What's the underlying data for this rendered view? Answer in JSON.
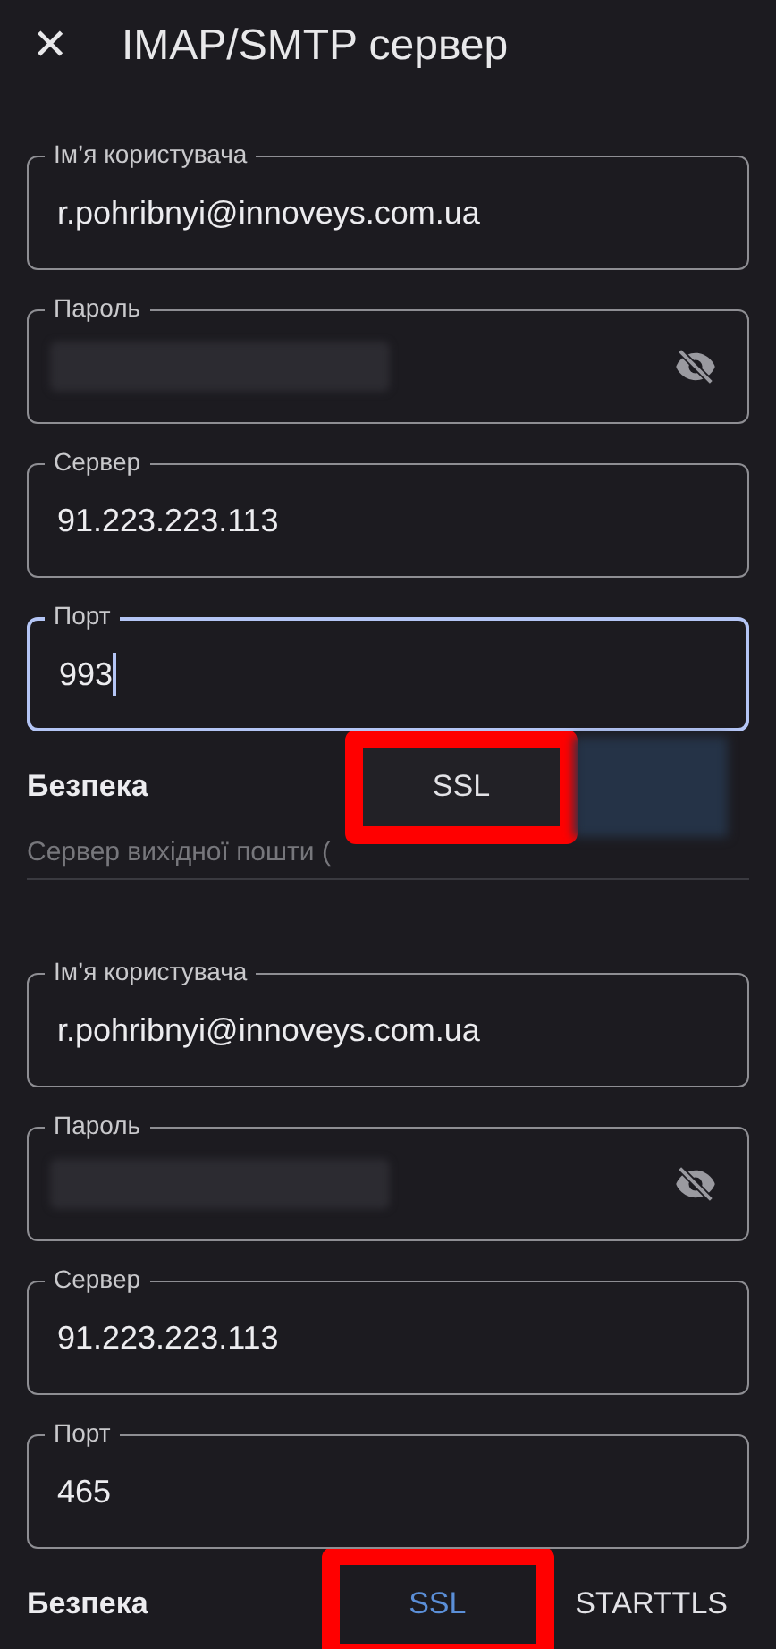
{
  "header": {
    "close_icon": "✕",
    "title": "IMAP/SMTP сервер"
  },
  "incoming": {
    "fields": [
      {
        "kind": "text",
        "label": "Ім’я користувача",
        "value": "r.pohribnyi@innoveys.com.ua",
        "focused": false
      },
      {
        "kind": "password",
        "label": "Пароль",
        "focused": false
      },
      {
        "kind": "text",
        "label": "Сервер",
        "value": "91.223.223.113",
        "focused": false
      },
      {
        "kind": "text",
        "label": "Порт",
        "value": "993",
        "focused": true
      }
    ],
    "security": {
      "label": "Безпека",
      "options": [
        {
          "label": "SSL",
          "selected": false,
          "highlighted": true,
          "kind": "menu"
        },
        {
          "kind": "blurred"
        }
      ]
    }
  },
  "outgoing": {
    "title": "Сервер вихідної пошти (",
    "fields": [
      {
        "kind": "text",
        "label": "Ім’я користувача",
        "value": "r.pohribnyi@innoveys.com.ua",
        "focused": false
      },
      {
        "kind": "password",
        "label": "Пароль",
        "focused": false
      },
      {
        "kind": "text",
        "label": "Сервер",
        "value": "91.223.223.113",
        "focused": false
      },
      {
        "kind": "text",
        "label": "Порт",
        "value": "465",
        "focused": false
      }
    ],
    "security": {
      "label": "Безпека",
      "options": [
        {
          "label": "SSL",
          "selected": true,
          "highlighted": true,
          "kind": "tab"
        },
        {
          "label": "STARTTLS",
          "selected": false,
          "highlighted": false,
          "kind": "tab"
        }
      ]
    }
  }
}
